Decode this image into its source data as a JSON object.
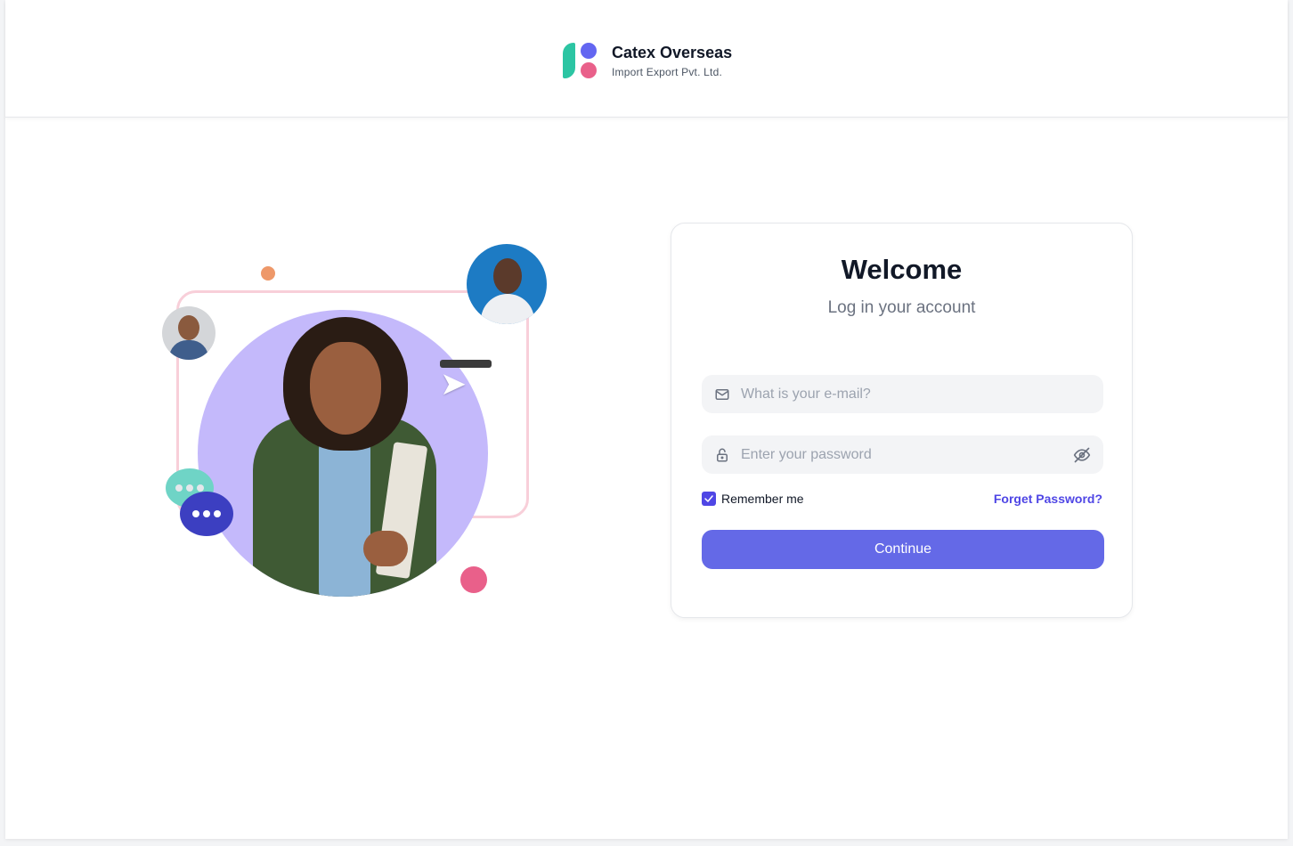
{
  "brand": {
    "name": "Catex Overseas",
    "subtitle": "Import Export Pvt. Ltd.",
    "colors": {
      "leaf": "#2cc5a3",
      "dot_top": "#6366f1",
      "dot_bottom": "#e9608a"
    }
  },
  "login": {
    "title": "Welcome",
    "subtitle": "Log in your account",
    "email": {
      "value": "",
      "placeholder": "What is your e-mail?",
      "icon": "mail-icon"
    },
    "password": {
      "value": "",
      "placeholder": "Enter your password",
      "icon": "lock-icon",
      "toggle_icon": "eye-off-icon"
    },
    "remember": {
      "label": "Remember me",
      "checked": true
    },
    "forgot_label": "Forget Password?",
    "continue_label": "Continue",
    "accent_color": "#6469e7"
  }
}
